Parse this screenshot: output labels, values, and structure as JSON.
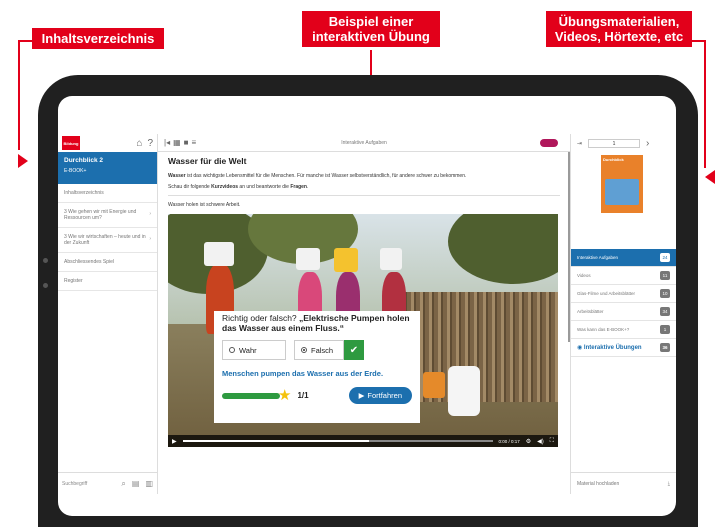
{
  "callouts": {
    "left": "Inhaltsverzeichnis",
    "middle_line1": "Beispiel einer",
    "middle_line2": "interaktiven Übung",
    "right_line1": "Übungsmaterialien,",
    "right_line2": "Videos, Hörtexte, etc"
  },
  "sidebar": {
    "book_title": "Durchblick 2",
    "book_subtitle": "E-BOOK+",
    "items": [
      {
        "label": "Inhaltsverzeichnis"
      },
      {
        "label": "3 Wie gehen wir mit Energie und Ressourcen um?"
      },
      {
        "label": "3 Wie wir wirtschaften – heute und in der Zukunft"
      },
      {
        "label": "Abschliessendes Spiel"
      },
      {
        "label": "Register"
      }
    ],
    "search_placeholder": "Suchbegriff"
  },
  "toolbar": {
    "title": "Interaktive Aufgaben"
  },
  "content": {
    "title": "Wasser für die Welt",
    "intro_bold": "Wasser",
    "intro_rest": " ist das wichtigste Lebensmittel für die Menschen. Für manche ist Wasser selbstverständlich, für andere schwer zu bekommen.",
    "task_prefix": "Schau dir folgende ",
    "task_bold1": "Kurzvideos",
    "task_mid": " an und beantworte die ",
    "task_bold2": "Fragen",
    "task_suffix": ".",
    "subtitle": "Wasser holen ist schwere Arbeit.",
    "video_time": "0:00 / 0:17"
  },
  "quiz": {
    "question_prefix": "Richtig oder falsch? ",
    "question_bold": "„Elektrische Pumpen holen das Wasser aus einem Fluss.“",
    "option_true": "Wahr",
    "option_false": "Falsch",
    "feedback": "Menschen pumpen das Wasser aus der Erde.",
    "score": "1/1",
    "continue_label": "Fortfahren",
    "progress": 1.0
  },
  "right_panel": {
    "page_number": "1",
    "cover_title": "Durchblick",
    "items": [
      {
        "label": "Interaktive Aufgaben",
        "count": "24"
      },
      {
        "label": "Videos",
        "count": "11"
      },
      {
        "label": "Glas-Filme und Arbeitsblätter",
        "count": "10"
      },
      {
        "label": "Arbeitsblätter",
        "count": "34"
      },
      {
        "label": "Was kann das E-BOOK+?",
        "count": "1"
      },
      {
        "label": "Interaktive Übungen",
        "count": "36"
      }
    ],
    "upload_label": "Material hochladen"
  },
  "colors": {
    "accent_red": "#e2001a",
    "brand_blue": "#1c6fae",
    "success_green": "#2e9a40"
  }
}
